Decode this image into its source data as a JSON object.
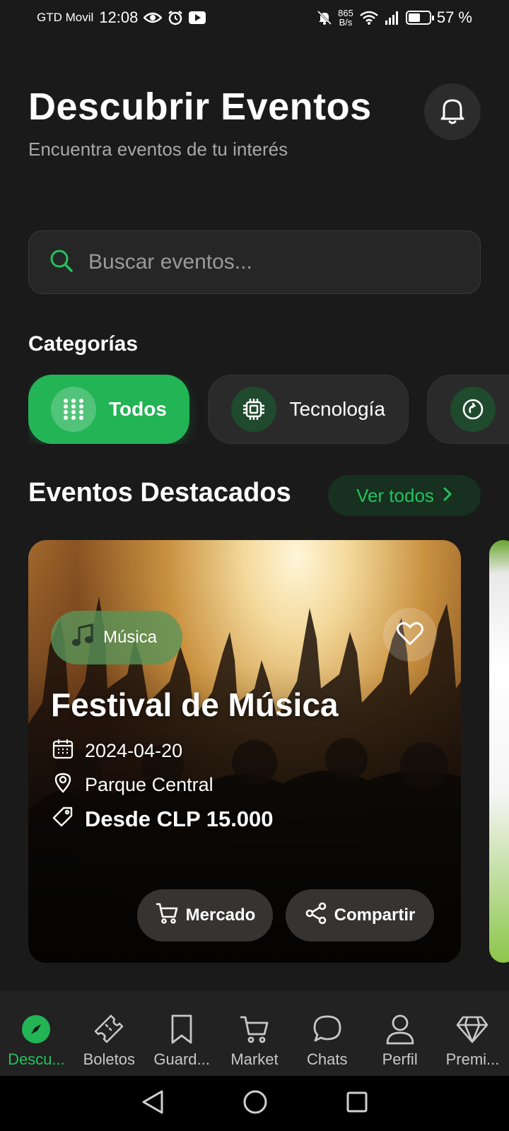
{
  "status_bar": {
    "carrier": "GTD Movil",
    "time": "12:08",
    "net_speed_value": "865",
    "net_speed_unit": "B/s",
    "battery": "57 %",
    "battery_level": 0.57
  },
  "header": {
    "title": "Descubrir Eventos",
    "subtitle": "Encuentra eventos de tu interés",
    "notification_icon": "bell-icon"
  },
  "search": {
    "placeholder": "Buscar eventos...",
    "value": ""
  },
  "categories": {
    "label": "Categorías",
    "items": [
      {
        "label": "Todos",
        "icon": "grid-icon",
        "active": true
      },
      {
        "label": "Tecnología",
        "icon": "chip-icon",
        "active": false
      },
      {
        "label": "",
        "icon": "refresh-icon",
        "active": false
      }
    ]
  },
  "featured": {
    "title": "Eventos Destacados",
    "view_all": "Ver todos",
    "event": {
      "category": "Música",
      "title": "Festival de Música",
      "date": "2024-04-20",
      "location": "Parque Central",
      "price": "Desde CLP 15.000",
      "market_label": "Mercado",
      "share_label": "Compartir"
    }
  },
  "bottom_nav": {
    "items": [
      {
        "label": "Descu...",
        "icon": "compass-icon",
        "active": true
      },
      {
        "label": "Boletos",
        "icon": "ticket-icon",
        "active": false
      },
      {
        "label": "Guard...",
        "icon": "bookmark-icon",
        "active": false
      },
      {
        "label": "Market",
        "icon": "cart-icon",
        "active": false
      },
      {
        "label": "Chats",
        "icon": "chat-icon",
        "active": false
      },
      {
        "label": "Perfil",
        "icon": "user-icon",
        "active": false
      },
      {
        "label": "Premi...",
        "icon": "diamond-icon",
        "active": false
      }
    ]
  },
  "colors": {
    "background": "#1a1a1a",
    "accent": "#22b455",
    "accent_text": "#22c25d"
  }
}
